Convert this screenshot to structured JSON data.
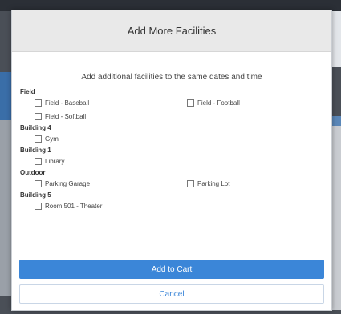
{
  "modal": {
    "title": "Add More Facilities",
    "subtitle": "Add additional facilities to the same dates and time",
    "groups": [
      {
        "name": "Field",
        "items": [
          "Field - Baseball",
          "Field - Football",
          "Field - Softball"
        ]
      },
      {
        "name": "Building 4",
        "items": [
          "Gym"
        ]
      },
      {
        "name": "Building 1",
        "items": [
          "Library"
        ]
      },
      {
        "name": "Outdoor",
        "items": [
          "Parking Garage",
          "Parking Lot"
        ]
      },
      {
        "name": "Building 5",
        "items": [
          "Room 501 - Theater"
        ]
      }
    ],
    "add_label": "Add to Cart",
    "cancel_label": "Cancel"
  },
  "colors": {
    "primary": "#3b86d8",
    "header_bg": "#e9e9e9"
  }
}
